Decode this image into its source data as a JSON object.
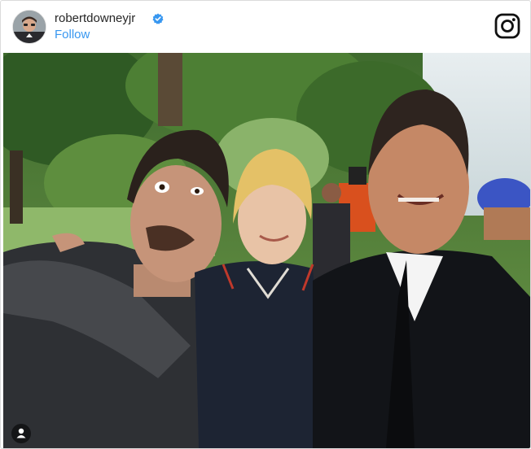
{
  "post": {
    "username": "robertdowneyjr",
    "follow_label": "Follow",
    "verified": true
  },
  "icons": {
    "verified": "verified-badge-icon",
    "instagram": "instagram-logo-icon",
    "user_tag": "user-tag-icon"
  },
  "colors": {
    "link": "#3897f0",
    "verified": "#3897f0",
    "text": "#262626",
    "border": "#dbdbdb"
  }
}
